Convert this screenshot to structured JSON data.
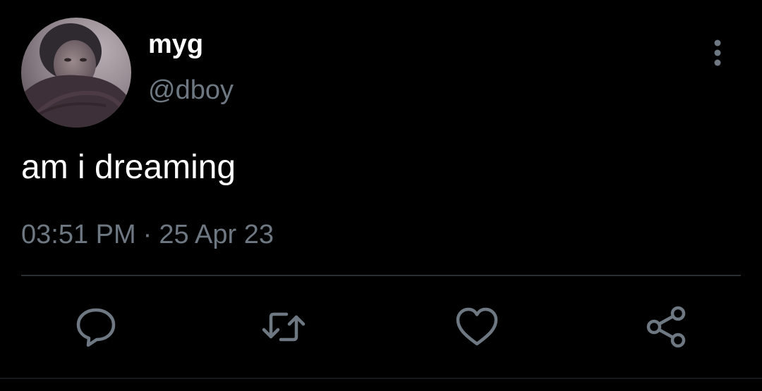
{
  "tweet": {
    "display_name": "myg",
    "handle": "@dboy",
    "text": "am i dreaming",
    "time": "03:51 PM",
    "separator": "·",
    "date": "25 Apr 23"
  },
  "icons": {
    "more": "more-vertical-icon",
    "reply": "reply-icon",
    "retweet": "retweet-icon",
    "like": "heart-icon",
    "share": "share-icon"
  },
  "colors": {
    "background": "#000000",
    "primary_text": "#ffffff",
    "secondary_text": "#6e7882",
    "icon": "#6e7882",
    "divider": "#2a2f34"
  }
}
